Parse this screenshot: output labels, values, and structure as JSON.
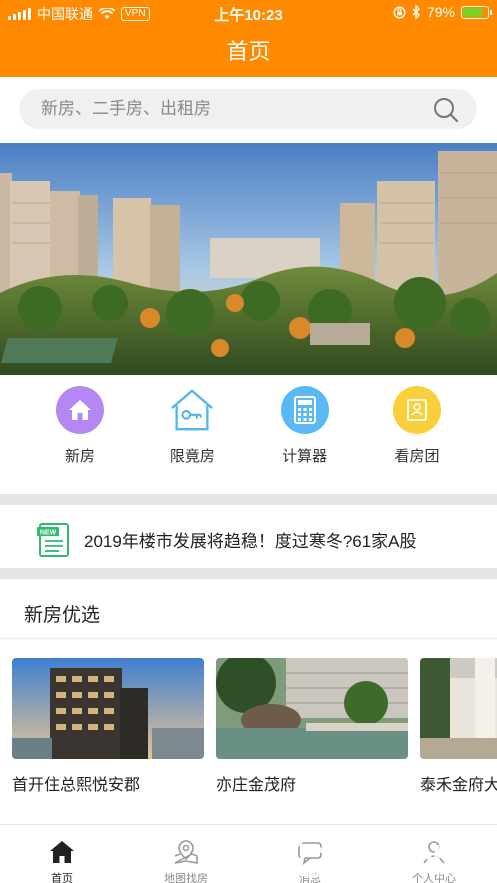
{
  "status_bar": {
    "carrier": "中国联通",
    "vpn": "VPN",
    "time": "上午10:23",
    "battery": "79%",
    "battery_level": 0.79
  },
  "header": {
    "title": "首页"
  },
  "search": {
    "placeholder": "新房、二手房、出租房"
  },
  "quick_entries": [
    {
      "label": "新房",
      "icon": "home-icon",
      "color": "#b388f5"
    },
    {
      "label": "限竟房",
      "icon": "house-key-icon",
      "color": "#5bc0f0"
    },
    {
      "label": "计算器",
      "icon": "calculator-icon",
      "color": "#5ab8f5"
    },
    {
      "label": "看房团",
      "icon": "badge-icon",
      "color": "#f9cf3b"
    }
  ],
  "news": {
    "icon": "news-icon",
    "text": "2019年楼市发展将趋稳！度过寒冬?61家A股"
  },
  "section": {
    "title": "新房优选",
    "cards": [
      {
        "name": "首开住总熙悦安郡"
      },
      {
        "name": "亦庄金茂府"
      },
      {
        "name": "泰禾金府大"
      }
    ]
  },
  "tabbar": {
    "tabs": [
      {
        "label": "首页",
        "icon": "home-icon",
        "active": true
      },
      {
        "label": "地图找房",
        "icon": "map-pin-icon",
        "active": false
      },
      {
        "label": "消息",
        "icon": "message-icon",
        "active": false
      },
      {
        "label": "个人中心",
        "icon": "user-icon",
        "active": false
      }
    ]
  },
  "colors": {
    "brand": "#ff8a00"
  }
}
